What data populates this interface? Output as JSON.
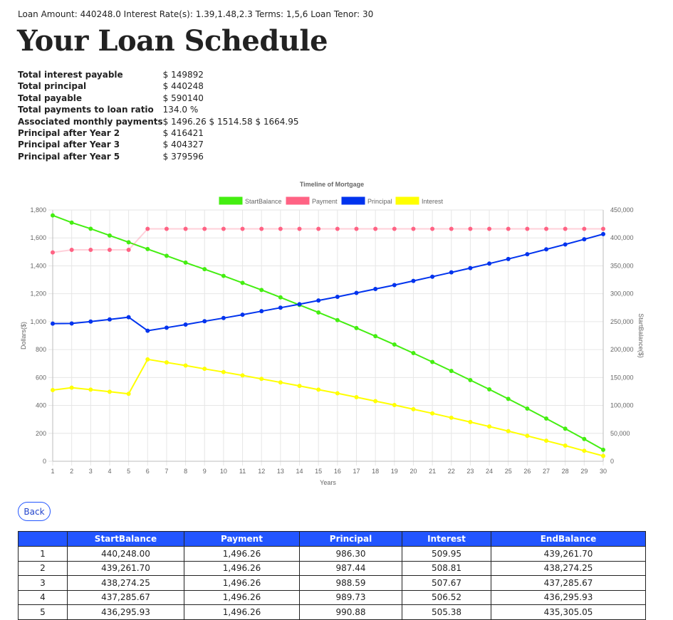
{
  "header": {
    "params": "Loan Amount: 440248.0 Interest Rate(s): 1.39,1.48,2.3 Terms: 1,5,6 Loan Tenor: 30",
    "title": "Your Loan Schedule"
  },
  "summary": [
    {
      "label": "Total interest payable",
      "value": "$ 149892"
    },
    {
      "label": "Total principal",
      "value": "$ 440248"
    },
    {
      "label": "Total payable",
      "value": "$ 590140"
    },
    {
      "label": "Total payments to loan ratio",
      "value": "134.0 %"
    },
    {
      "label": "Associated monthly payments",
      "value": "$ 1496.26 $ 1514.58 $ 1664.95"
    },
    {
      "label": "Principal after Year 2",
      "value": "$ 416421"
    },
    {
      "label": "Principal after Year 3",
      "value": "$ 404327"
    },
    {
      "label": "Principal after Year 5",
      "value": "$ 379596"
    }
  ],
  "chart_data": {
    "type": "line",
    "title": "Timeline of Mortgage",
    "xlabel": "Years",
    "ylabel": "Dollars($)",
    "ylabel_right": "StartBalance($)",
    "x": [
      1,
      2,
      3,
      4,
      5,
      6,
      7,
      8,
      9,
      10,
      11,
      12,
      13,
      14,
      15,
      16,
      17,
      18,
      19,
      20,
      21,
      22,
      23,
      24,
      25,
      26,
      27,
      28,
      29,
      30
    ],
    "ylim": [
      0,
      1800
    ],
    "yticks": [
      0,
      200,
      400,
      600,
      800,
      1000,
      1200,
      1400,
      1600,
      1800
    ],
    "ylim_right": [
      0,
      450000
    ],
    "yticks_right": [
      0,
      50000,
      100000,
      150000,
      200000,
      250000,
      300000,
      350000,
      400000,
      450000
    ],
    "grid": true,
    "legend_position": "top",
    "series": [
      {
        "name": "StartBalance",
        "axis": "right",
        "color": "#44ee11",
        "values": [
          440248,
          427400,
          416421,
          404327,
          392200,
          380000,
          368000,
          355800,
          344000,
          332000,
          319500,
          306800,
          293500,
          280000,
          266500,
          252800,
          238600,
          224000,
          209000,
          193700,
          177800,
          161800,
          145300,
          128700,
          111700,
          94300,
          76500,
          58300,
          39800,
          20600
        ]
      },
      {
        "name": "Payment",
        "axis": "left",
        "color": "#ff6384",
        "values": [
          1496.26,
          1514.58,
          1514.58,
          1514.58,
          1514.58,
          1664.95,
          1664.95,
          1664.95,
          1664.95,
          1664.95,
          1664.95,
          1664.95,
          1664.95,
          1664.95,
          1664.95,
          1664.95,
          1664.95,
          1664.95,
          1664.95,
          1664.95,
          1664.95,
          1664.95,
          1664.95,
          1664.95,
          1664.95,
          1664.95,
          1664.95,
          1664.95,
          1664.95,
          1664.95
        ]
      },
      {
        "name": "Principal",
        "axis": "left",
        "color": "#0033ee",
        "values": [
          986,
          987,
          1001,
          1016,
          1032,
          935,
          957,
          979,
          1003,
          1026,
          1050,
          1075,
          1100,
          1125,
          1152,
          1178,
          1206,
          1234,
          1262,
          1292,
          1322,
          1353,
          1384,
          1416,
          1449,
          1483,
          1518,
          1553,
          1590,
          1627
        ]
      },
      {
        "name": "Interest",
        "axis": "left",
        "color": "#ffff00",
        "values": [
          510,
          527,
          513,
          498,
          483,
          730,
          708,
          686,
          662,
          639,
          615,
          590,
          565,
          540,
          513,
          487,
          459,
          431,
          403,
          373,
          343,
          312,
          281,
          249,
          216,
          182,
          147,
          112,
          75,
          38
        ]
      }
    ]
  },
  "back_button": {
    "label": "Back"
  },
  "schedule": {
    "columns": [
      "",
      "StartBalance",
      "Payment",
      "Principal",
      "Interest",
      "EndBalance"
    ],
    "rows": [
      [
        "1",
        "440,248.00",
        "1,496.26",
        "986.30",
        "509.95",
        "439,261.70"
      ],
      [
        "2",
        "439,261.70",
        "1,496.26",
        "987.44",
        "508.81",
        "438,274.25"
      ],
      [
        "3",
        "438,274.25",
        "1,496.26",
        "988.59",
        "507.67",
        "437,285.67"
      ],
      [
        "4",
        "437,285.67",
        "1,496.26",
        "989.73",
        "506.52",
        "436,295.93"
      ],
      [
        "5",
        "436,295.93",
        "1,496.26",
        "990.88",
        "505.38",
        "435,305.05"
      ]
    ]
  }
}
